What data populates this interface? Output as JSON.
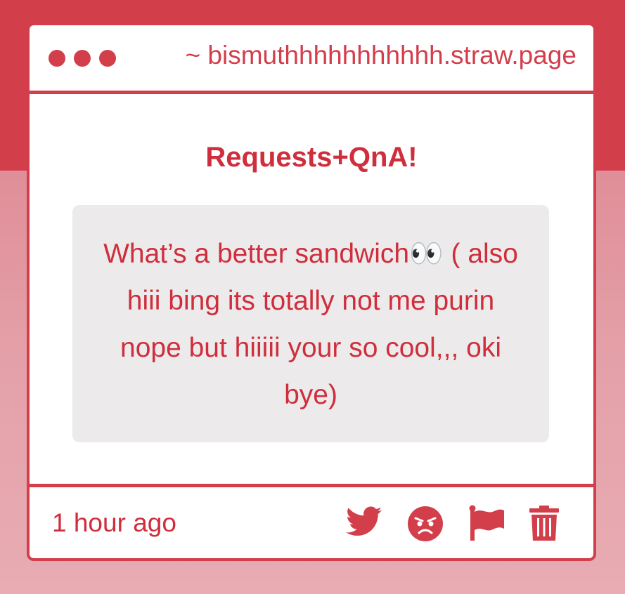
{
  "colors": {
    "accent": "#d33e4b",
    "text": "#cf2e3c",
    "message_bg": "#eceaeb",
    "card_bg": "#ffffff"
  },
  "window": {
    "url": "~ bismuthhhhhhhhhhh.straw.page",
    "dots": [
      "dot",
      "dot",
      "dot"
    ]
  },
  "main": {
    "title": "Requests+QnA!",
    "message": "What’s a better sandwich👀 ( also hiii bing its totally not me purin nope but hiiiii your so cool,,, oki bye)"
  },
  "footer": {
    "timestamp": "1 hour ago",
    "actions": [
      {
        "icon": "twitter-icon",
        "label": "share on twitter"
      },
      {
        "icon": "angry-face-icon",
        "label": "react angry"
      },
      {
        "icon": "flag-icon",
        "label": "report"
      },
      {
        "icon": "trash-icon",
        "label": "delete"
      }
    ]
  }
}
